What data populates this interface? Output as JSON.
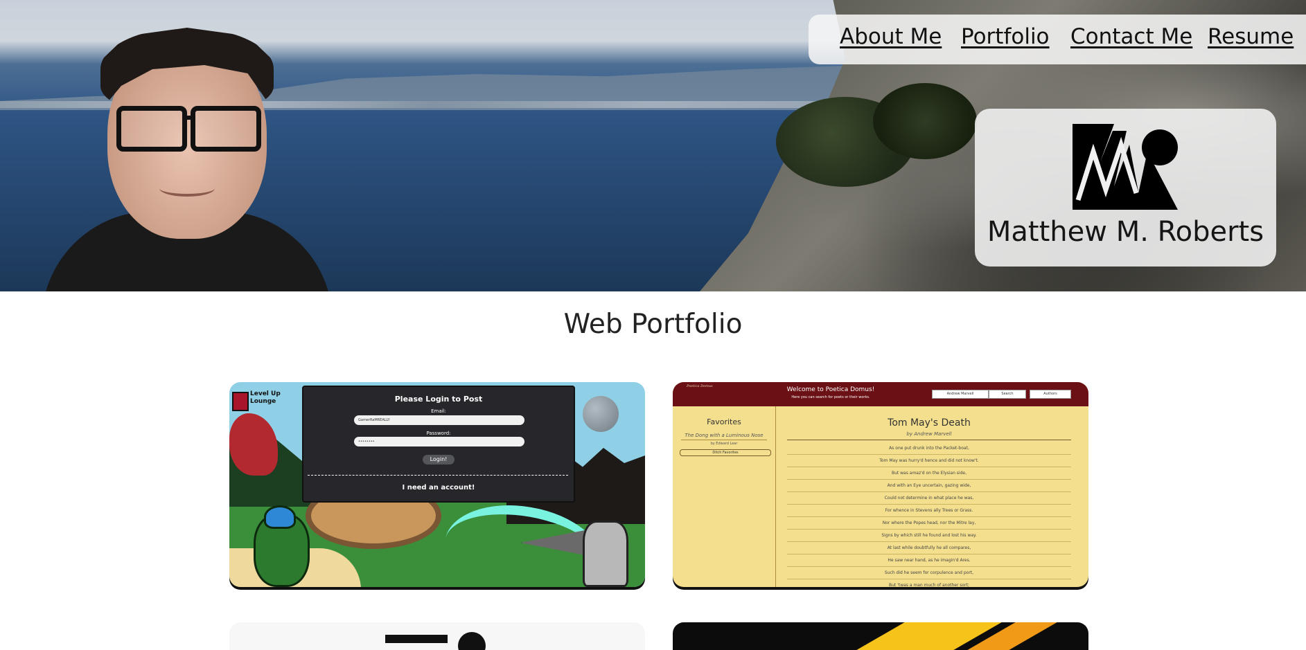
{
  "nav": {
    "about": "About Me",
    "portfolio": "Portfolio",
    "contact": "Contact Me",
    "resume": "Resume"
  },
  "logo": {
    "name": "Matthew M. Roberts"
  },
  "main": {
    "section_title": "Web Portfolio"
  },
  "card1": {
    "app_logo": "Level Up\nLounge",
    "login_title": "Please Login to Post",
    "email_label": "Email:",
    "email_value": "GamerRaMREALLY",
    "password_label": "Password:",
    "password_value": "••••••••",
    "login_button": "Login!",
    "account_link": "I need an account!"
  },
  "card2": {
    "logo_text": "Poetica Domus",
    "welcome": "Welcome to Poetica Domus!",
    "subtitle": "Here you can search for poets or their works.",
    "search_value": "Andrew Marvell",
    "search_button": "Search",
    "authors_button": "Authors",
    "favorites_title": "Favorites",
    "favorite_item": "The Dong with a Luminous Nose",
    "favorite_by": "by Edward Lear",
    "clear_button": "Ditch Favorites",
    "poem_title": "Tom May's Death",
    "poem_author": "by Andrew Marvell",
    "poem_lines": [
      "As one put drunk into the Packet-boat,",
      "Tom May was hurry'd hence and did not know't.",
      "But was amaz'd on the Elysian side,",
      "And with an Eye uncertain, gazing wide,",
      "Could not determine in what place he was,",
      "For whence in Stevens ally Trees or Grass.",
      "Nor where the Popes head, nor the Mitre lay,",
      "Signs by which still he found and lost his way.",
      "At last while doubtfully he all compares,",
      "He saw near hand, as he imagin'd Ares.",
      "Such did he seem for corpulence and port,",
      "But 'twas a man much of another sort;"
    ]
  }
}
